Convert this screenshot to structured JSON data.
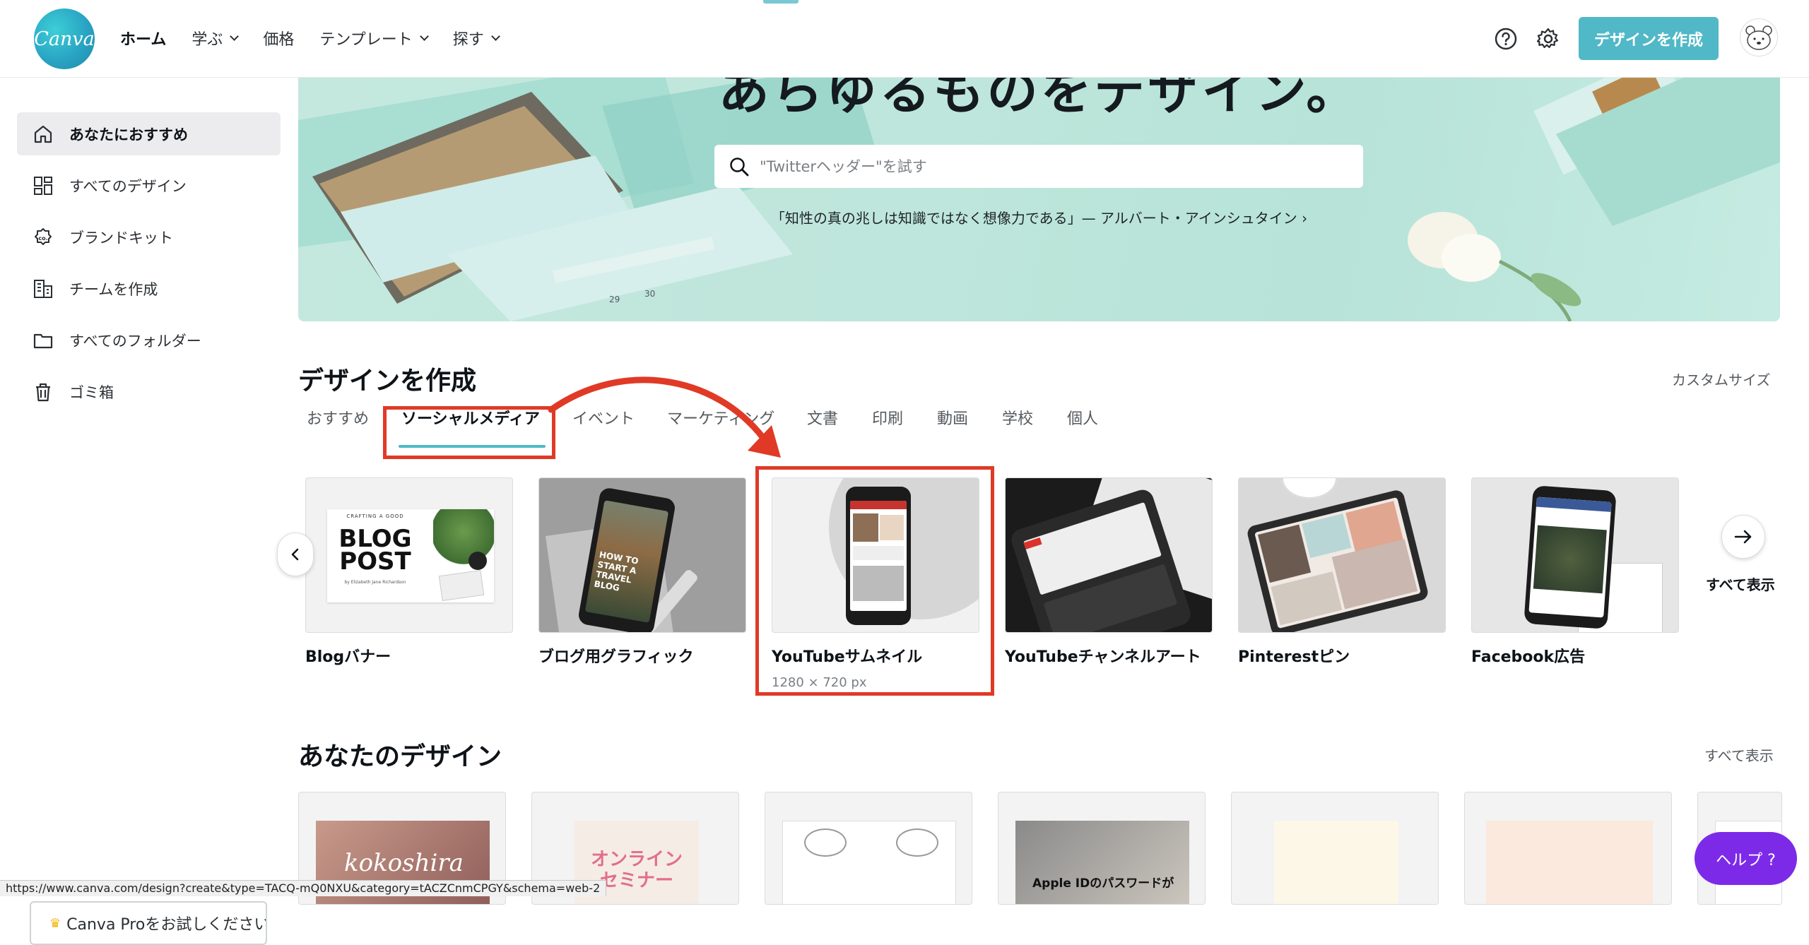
{
  "header": {
    "logo_text": "Canva",
    "nav": [
      {
        "label": "ホーム",
        "dropdown": false,
        "active": true
      },
      {
        "label": "学ぶ",
        "dropdown": true
      },
      {
        "label": "価格",
        "dropdown": false
      },
      {
        "label": "テンプレート",
        "dropdown": true
      },
      {
        "label": "探す",
        "dropdown": true
      }
    ],
    "create_button": "デザインを作成"
  },
  "sidebar": {
    "items": [
      {
        "label": "あなたにおすすめ",
        "icon": "home-icon",
        "active": true
      },
      {
        "label": "すべてのデザイン",
        "icon": "grid-icon"
      },
      {
        "label": "ブランドキット",
        "icon": "brand-kit-icon"
      },
      {
        "label": "チームを作成",
        "icon": "team-icon"
      },
      {
        "label": "すべてのフォルダー",
        "icon": "folder-icon"
      },
      {
        "label": "ゴミ箱",
        "icon": "trash-icon"
      }
    ],
    "pro_button": "Canva Proをお試しください"
  },
  "hero": {
    "title": "あらゆるものをデザイン。",
    "search_placeholder": "\"Twitterヘッダー\"を試す",
    "quote": "「知性の真の兆しは知識ではなく想像力である」— アルバート・アインシュタイン ›"
  },
  "create_section": {
    "title": "デザインを作成",
    "custom_size": "カスタムサイズ",
    "tabs": [
      "おすすめ",
      "ソーシャルメディア",
      "イベント",
      "マーケティング",
      "文書",
      "印刷",
      "動画",
      "学校",
      "個人"
    ],
    "active_tab": "ソーシャルメディア",
    "cards": [
      {
        "label": "Blogバナー",
        "sub": ""
      },
      {
        "label": "ブログ用グラフィック",
        "sub": ""
      },
      {
        "label": "YouTubeサムネイル",
        "sub": "1280 × 720 px"
      },
      {
        "label": "YouTubeチャンネルアート",
        "sub": ""
      },
      {
        "label": "Pinterestピン",
        "sub": ""
      },
      {
        "label": "Facebook広告",
        "sub": ""
      }
    ],
    "show_all": "すべて表示",
    "blog_thumb": {
      "line1": "CRAFTING A GOOD",
      "line2": "BLOG",
      "line3": "POST",
      "line4": "by Elizabeth Jane Richardson"
    },
    "travel_thumb": [
      "HOW TO",
      "START A",
      "TRAVEL",
      "BLOG"
    ]
  },
  "your_designs": {
    "title": "あなたのデザイン",
    "show_all": "すべて表示",
    "previews": [
      "kokoshira",
      "オンライン\nセミナー",
      "",
      "Apple IDのパスワードが",
      "",
      "",
      ""
    ]
  },
  "help_button": "ヘルプ ?",
  "status_url": "https://www.canva.com/design?create&type=TACQ-mQ0NXU&category=tACZCnmCPGY&schema=web-2",
  "colors": {
    "accent": "#51b8c7",
    "annotation": "#e03a26",
    "help": "#7d2ae8"
  }
}
